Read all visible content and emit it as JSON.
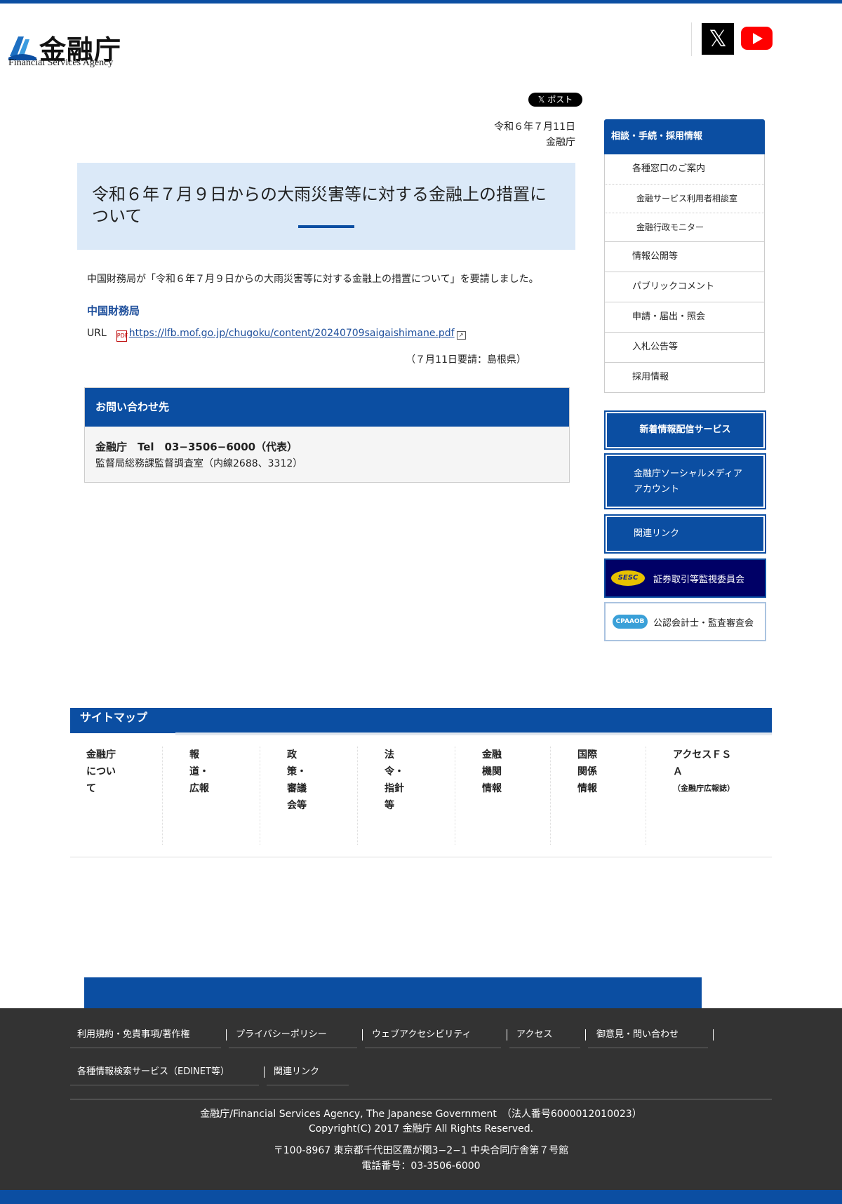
{
  "header": {
    "logo_jp": "金融庁",
    "logo_en": "Financial Services Agency",
    "x_icon": "𝕏"
  },
  "share": {
    "post_label": "𝕏 ポスト"
  },
  "article": {
    "date": "令和６年７月11日",
    "org": "金融庁",
    "title": "令和６年７月９日からの大雨災害等に対する金融上の措置について",
    "body": "中国財務局が「令和６年７月９日からの大雨災害等に対する金融上の措置について」を要請しました。",
    "bureau": "中国財務局",
    "url_label": "URL",
    "url": "https://lfb.mof.go.jp/chugoku/content/20240709saigaishimane.pdf",
    "note": "（７月11日要請：島根県）"
  },
  "contact": {
    "heading": "お問い合わせ先",
    "line1": "金融庁　Tel　03−3506−6000（代表）",
    "line2": "監督局総務課監督調査室（内線2688、3312）"
  },
  "sidebar": {
    "heading": "相談・手続・採用情報",
    "items": [
      {
        "label": "各種窓口のご案内",
        "sub": false
      },
      {
        "label": "金融サービス利用者相談室",
        "sub": true
      },
      {
        "label": "金融行政モニター",
        "sub": true
      },
      {
        "label": "情報公開等",
        "sub": false
      },
      {
        "label": "パブリックコメント",
        "sub": false
      },
      {
        "label": "申請・届出・照会",
        "sub": false
      },
      {
        "label": "入札公告等",
        "sub": false
      },
      {
        "label": "採用情報",
        "sub": false
      }
    ],
    "buttons": {
      "news": "新着情報配信サービス",
      "social_1": "金融庁ソーシャルメディア",
      "social_2": "アカウント",
      "links": "関連リンク",
      "sesc": "証券取引等監視委員会",
      "sesc_logo": "SESC",
      "cpaaob": "公認会計士・監査審査会",
      "cpaaob_logo": "CPAAOB"
    }
  },
  "sitemap": {
    "title": "サイトマップ",
    "columns": [
      {
        "lines": [
          "金融庁",
          "につい",
          "て"
        ]
      },
      {
        "lines": [
          "報",
          "道・",
          "広報"
        ]
      },
      {
        "lines": [
          "政",
          "策・",
          "審議",
          "会等"
        ]
      },
      {
        "lines": [
          "法",
          "令・",
          "指針",
          "等"
        ]
      },
      {
        "lines": [
          "金融",
          "機関",
          "情報"
        ]
      },
      {
        "lines": [
          "国際",
          "関係",
          "情報"
        ]
      },
      {
        "lines": [
          "アクセスＦＳ",
          "Ａ"
        ],
        "small": "（金融庁広報誌）"
      }
    ]
  },
  "footer": {
    "links_row1": [
      "利用規約・免責事項/著作権",
      "プライバシーポリシー",
      "ウェブアクセシビリティ",
      "アクセス",
      "御意見・問い合わせ"
    ],
    "links_row2": [
      "各種情報検索サービス（EDINET等）",
      "関連リンク"
    ],
    "line1": "金融庁/Financial Services Agency, The Japanese Government　（法人番号6000012010023）",
    "line2": "Copyright(C) 2017 金融庁 All Rights Reserved.",
    "line3": "〒100-8967 東京都千代田区霞が関3−2−1 中央合同庁舎第７号館",
    "line4": "電話番号：03-3506-6000"
  }
}
